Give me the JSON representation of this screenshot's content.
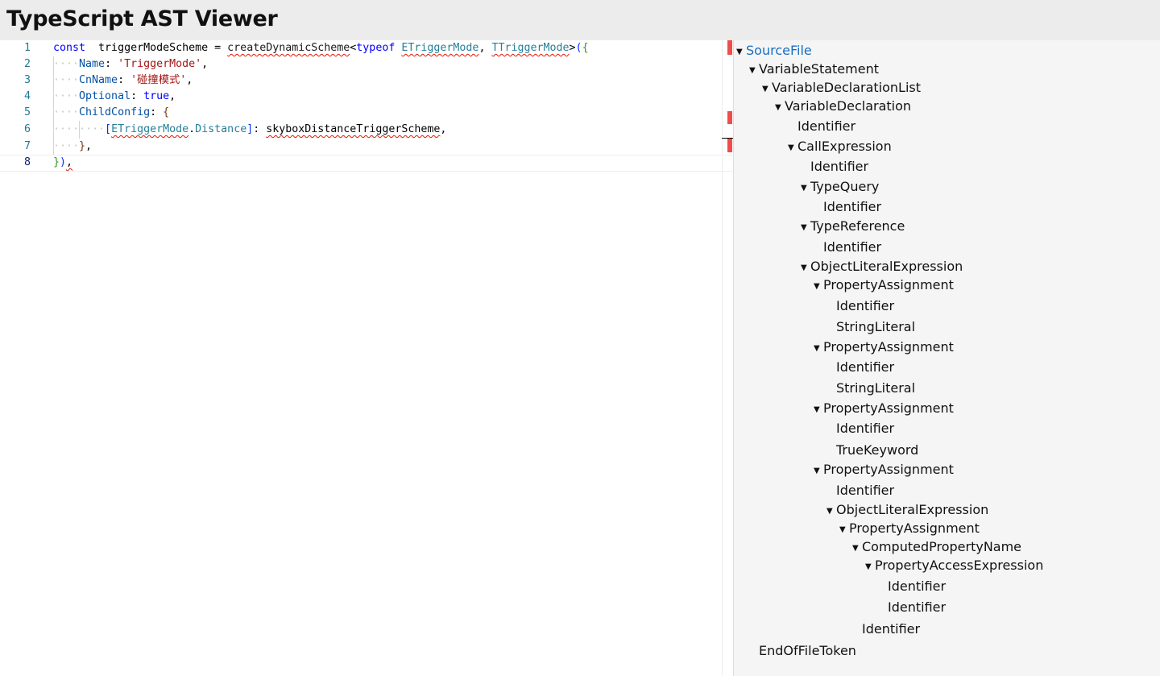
{
  "app": {
    "title": "TypeScript AST Viewer"
  },
  "editor": {
    "lines": [
      {
        "n": "1",
        "tokens": [
          {
            "t": "const",
            "c": "kw"
          },
          {
            "t": "  ",
            "c": "txt"
          },
          {
            "t": "triggerModeScheme",
            "c": "txt"
          },
          {
            "t": " = ",
            "c": "txt"
          },
          {
            "t": "createDynamicScheme",
            "c": "fn",
            "s": true
          },
          {
            "t": "<",
            "c": "txt"
          },
          {
            "t": "typeof",
            "c": "kw"
          },
          {
            "t": " ",
            "c": "txt"
          },
          {
            "t": "ETriggerMode",
            "c": "type",
            "s": true
          },
          {
            "t": ", ",
            "c": "txt"
          },
          {
            "t": "TTriggerMode",
            "c": "type",
            "s": true
          },
          {
            "t": ">",
            "c": "txt"
          },
          {
            "t": "(",
            "c": "brk1"
          },
          {
            "t": "{",
            "c": "brk2"
          }
        ]
      },
      {
        "n": "2",
        "tokens": [
          {
            "t": "····",
            "c": "ws"
          },
          {
            "t": "Name",
            "c": "prop"
          },
          {
            "t": ": ",
            "c": "txt"
          },
          {
            "t": "'TriggerMode'",
            "c": "str"
          },
          {
            "t": ",",
            "c": "txt"
          }
        ]
      },
      {
        "n": "3",
        "tokens": [
          {
            "t": "····",
            "c": "ws"
          },
          {
            "t": "CnName",
            "c": "prop"
          },
          {
            "t": ": ",
            "c": "txt"
          },
          {
            "t": "'碰撞模式'",
            "c": "str"
          },
          {
            "t": ",",
            "c": "txt"
          }
        ]
      },
      {
        "n": "4",
        "tokens": [
          {
            "t": "····",
            "c": "ws"
          },
          {
            "t": "Optional",
            "c": "prop"
          },
          {
            "t": ": ",
            "c": "txt"
          },
          {
            "t": "true",
            "c": "kw"
          },
          {
            "t": ",",
            "c": "txt"
          }
        ]
      },
      {
        "n": "5",
        "tokens": [
          {
            "t": "····",
            "c": "ws"
          },
          {
            "t": "ChildConfig",
            "c": "prop"
          },
          {
            "t": ": ",
            "c": "txt"
          },
          {
            "t": "{",
            "c": "brk3"
          }
        ]
      },
      {
        "n": "6",
        "tokens": [
          {
            "t": "········",
            "c": "ws"
          },
          {
            "t": "[",
            "c": "brk1"
          },
          {
            "t": "ETriggerMode",
            "c": "type",
            "s": true
          },
          {
            "t": ".",
            "c": "txt"
          },
          {
            "t": "Distance",
            "c": "type"
          },
          {
            "t": "]",
            "c": "brk1"
          },
          {
            "t": ": ",
            "c": "txt"
          },
          {
            "t": "skyboxDistanceTriggerScheme",
            "c": "txt",
            "s": true
          },
          {
            "t": ",",
            "c": "txt"
          }
        ]
      },
      {
        "n": "7",
        "tokens": [
          {
            "t": "····",
            "c": "ws"
          },
          {
            "t": "}",
            "c": "brk3"
          },
          {
            "t": ",",
            "c": "txt"
          }
        ]
      },
      {
        "n": "8",
        "tokens": [
          {
            "t": "}",
            "c": "brk2"
          },
          {
            "t": ")",
            "c": "brk1"
          },
          {
            "t": ",",
            "c": "txt",
            "s": true
          }
        ]
      }
    ]
  },
  "tree": {
    "nodes": [
      {
        "label": "SourceFile",
        "depth": 0,
        "expanded": true,
        "selected": true
      },
      {
        "label": "VariableStatement",
        "depth": 1,
        "expanded": true
      },
      {
        "label": "VariableDeclarationList",
        "depth": 2,
        "expanded": true
      },
      {
        "label": "VariableDeclaration",
        "depth": 3,
        "expanded": true
      },
      {
        "label": "Identifier",
        "depth": 4,
        "expanded": false
      },
      {
        "label": "CallExpression",
        "depth": 4,
        "expanded": true
      },
      {
        "label": "Identifier",
        "depth": 5,
        "expanded": false
      },
      {
        "label": "TypeQuery",
        "depth": 5,
        "expanded": true
      },
      {
        "label": "Identifier",
        "depth": 6,
        "expanded": false
      },
      {
        "label": "TypeReference",
        "depth": 5,
        "expanded": true
      },
      {
        "label": "Identifier",
        "depth": 6,
        "expanded": false
      },
      {
        "label": "ObjectLiteralExpression",
        "depth": 5,
        "expanded": true
      },
      {
        "label": "PropertyAssignment",
        "depth": 6,
        "expanded": true
      },
      {
        "label": "Identifier",
        "depth": 7,
        "expanded": false
      },
      {
        "label": "StringLiteral",
        "depth": 7,
        "expanded": false
      },
      {
        "label": "PropertyAssignment",
        "depth": 6,
        "expanded": true
      },
      {
        "label": "Identifier",
        "depth": 7,
        "expanded": false
      },
      {
        "label": "StringLiteral",
        "depth": 7,
        "expanded": false
      },
      {
        "label": "PropertyAssignment",
        "depth": 6,
        "expanded": true
      },
      {
        "label": "Identifier",
        "depth": 7,
        "expanded": false
      },
      {
        "label": "TrueKeyword",
        "depth": 7,
        "expanded": false
      },
      {
        "label": "PropertyAssignment",
        "depth": 6,
        "expanded": true
      },
      {
        "label": "Identifier",
        "depth": 7,
        "expanded": false
      },
      {
        "label": "ObjectLiteralExpression",
        "depth": 7,
        "expanded": true
      },
      {
        "label": "PropertyAssignment",
        "depth": 8,
        "expanded": true
      },
      {
        "label": "ComputedPropertyName",
        "depth": 9,
        "expanded": true
      },
      {
        "label": "PropertyAccessExpression",
        "depth": 10,
        "expanded": true
      },
      {
        "label": "Identifier",
        "depth": 11,
        "expanded": false
      },
      {
        "label": "Identifier",
        "depth": 11,
        "expanded": false
      },
      {
        "label": "Identifier",
        "depth": 9,
        "expanded": false
      },
      {
        "label": "EndOfFileToken",
        "depth": 1,
        "expanded": false
      }
    ]
  }
}
